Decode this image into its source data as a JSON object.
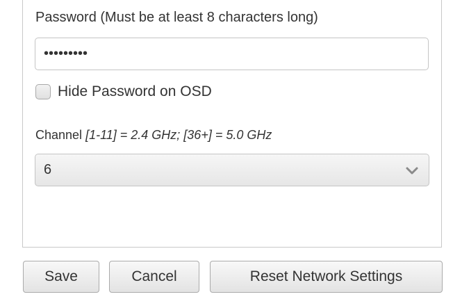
{
  "password": {
    "label": "Password (Must be at least 8 characters long)",
    "masked_value": "•••••••••"
  },
  "hide_password": {
    "label": "Hide Password on OSD",
    "checked": false
  },
  "channel": {
    "label_prefix": "Channel ",
    "label_range": "[1-11] = 2.4 GHz; [36+] = 5.0 GHz",
    "selected_value": "6",
    "icon": "chevron-down-icon"
  },
  "actions": {
    "save_label": "Save",
    "cancel_label": "Cancel",
    "reset_label": "Reset Network Settings"
  },
  "colors": {
    "text": "#333333",
    "border": "#c4c4c4"
  }
}
